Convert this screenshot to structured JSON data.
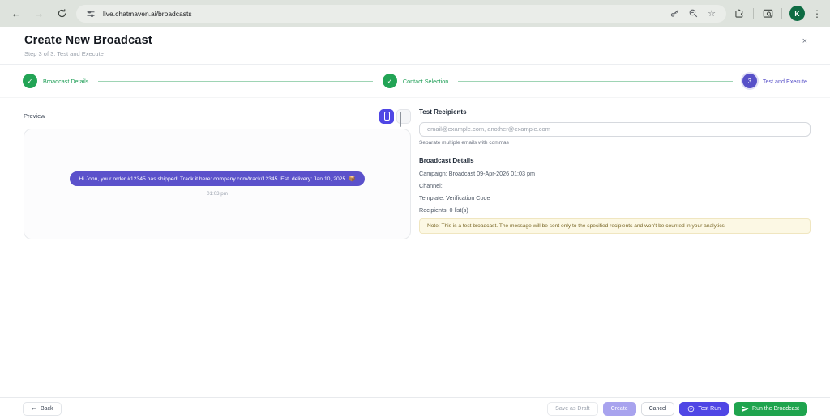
{
  "browser": {
    "url": "live.chatmaven.ai/broadcasts",
    "avatar_initial": "K"
  },
  "header": {
    "title": "Create New Broadcast",
    "subtitle": "Step 3 of 3: Test and Execute",
    "close_label": "×"
  },
  "stepper": {
    "steps": [
      {
        "label": "Broadcast Details",
        "state": "complete",
        "glyph": "✓"
      },
      {
        "label": "Contact Selection",
        "state": "complete",
        "glyph": "✓"
      },
      {
        "label": "Test and Execute",
        "state": "current",
        "glyph": "3"
      }
    ]
  },
  "preview": {
    "label": "Preview",
    "message": "Hi John, your order #12345 has shipped! Track it here: company.com/track/12345. Est. delivery: Jan 10, 2025. 📦",
    "timestamp": "01:03 pm"
  },
  "form": {
    "test_recipients_label": "Test Recipients",
    "test_recipients_placeholder": "email@example.com, another@example.com",
    "test_recipients_help": "Separate multiple emails with commas",
    "details_title": "Broadcast Details",
    "details": [
      "Campaign: Broadcast 09-Apr-2026 01:03 pm",
      "Channel:",
      "Template: Verification Code",
      "Recipients: 0 list(s)"
    ],
    "note": "Note: This is a test broadcast. The message will be sent only to the specified recipients and won't be counted in your analytics."
  },
  "footer": {
    "back": "Back",
    "save_draft": "Save as Draft",
    "create": "Create",
    "cancel": "Cancel",
    "test_run": "Test Run",
    "run_broadcast": "Run the Broadcast"
  },
  "colors": {
    "accent_indigo": "#4f46e5",
    "bubble_indigo": "#5b51cb",
    "accent_green": "#22a455",
    "note_bg": "#fcf8e4",
    "note_border": "#f0e6c0",
    "avatar_green": "#0e6c43"
  }
}
